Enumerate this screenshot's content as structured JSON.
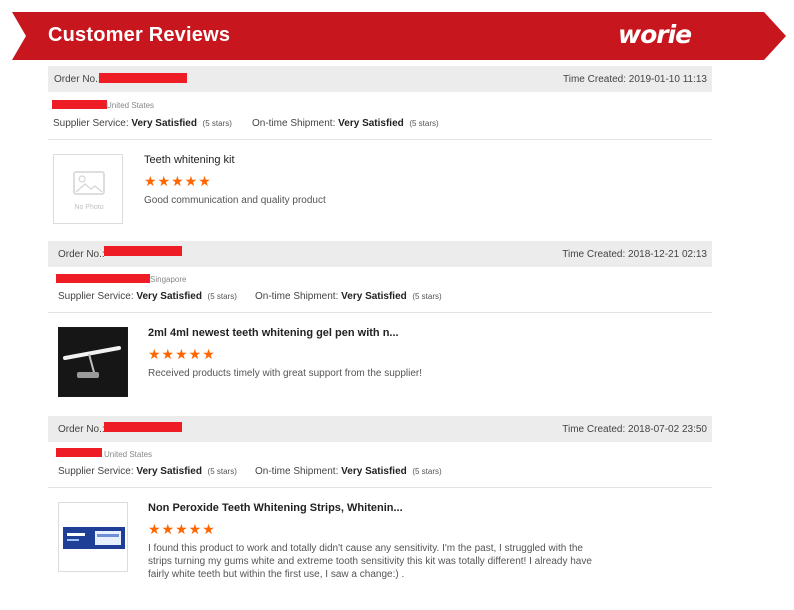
{
  "header": {
    "title": "Customer Reviews",
    "logo_text": "worie"
  },
  "labels": {
    "order_no": "Order No.:",
    "time_created_prefix": "Time Created:",
    "supplier_service": "Supplier Service:",
    "ontime_shipment": "On-time Shipment:",
    "no_photo": "No Photo"
  },
  "reviews": [
    {
      "time_created": "2019-01-10 11:13",
      "country": "United States",
      "supplier_rating": "Very Satisfied",
      "supplier_stars": "(5 stars)",
      "shipment_rating": "Very Satisfied",
      "shipment_stars": "(5 stars)",
      "product_title": "Teeth whitening kit",
      "stars": "★★★★★",
      "star_rating": 5,
      "comment": "Good communication and quality product"
    },
    {
      "time_created": "2018-12-21 02:13",
      "country": "Singapore",
      "supplier_rating": "Very Satisfied",
      "supplier_stars": "(5 stars)",
      "shipment_rating": "Very Satisfied",
      "shipment_stars": "(5 stars)",
      "product_title": "2ml 4ml newest teeth whitening gel pen with n...",
      "stars": "★★★★★",
      "star_rating": 5,
      "comment": "Received products timely with great support from the supplier!"
    },
    {
      "time_created": "2018-07-02 23:50",
      "country": "United States",
      "supplier_rating": "Very Satisfied",
      "supplier_stars": "(5 stars)",
      "shipment_rating": "Very Satisfied",
      "shipment_stars": "(5 stars)",
      "product_title": "Non Peroxide Teeth Whitening Strips, Whitenin...",
      "stars": "★★★★★",
      "star_rating": 5,
      "comment": "I found this product to work and totally didn't cause any sensitivity. I'm the past, I struggled with the strips turning my gums white and extreme tooth sensitivity this kit was totally different! I already have fairly white teeth but within the first use, I saw a change:) ."
    }
  ],
  "colors": {
    "banner_red": "#c8161e",
    "star_orange": "#ff6600",
    "redaction": "#ee1c25",
    "bar_gray": "#ececec"
  }
}
